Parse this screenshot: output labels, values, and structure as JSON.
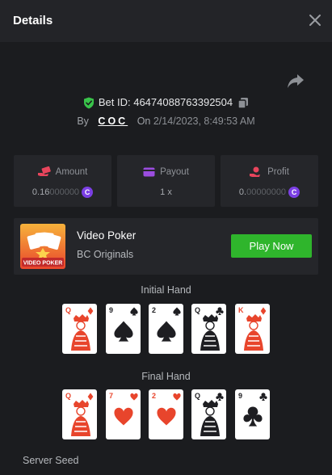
{
  "header": {
    "title": "Details"
  },
  "bet": {
    "id_text": "Bet ID: 46474088763392504",
    "by_label": "By",
    "user": "COC",
    "on_label": "On",
    "date": "2/14/2023, 8:49:53 AM"
  },
  "stats": {
    "amount": {
      "label": "Amount",
      "value_main": "0.16",
      "value_dim": "000000"
    },
    "payout": {
      "label": "Payout",
      "value": "1 x"
    },
    "profit": {
      "label": "Profit",
      "value_main": "0.",
      "value_dim": "00000000"
    }
  },
  "game": {
    "name": "Video Poker",
    "provider": "BC Originals",
    "thumb_text": "VIDEO POKER",
    "play_label": "Play Now"
  },
  "initial_hand": {
    "label": "Initial Hand",
    "cards": [
      {
        "rank": "Q",
        "suit": "diamonds",
        "color": "#e8452c"
      },
      {
        "rank": "9",
        "suit": "spades",
        "color": "#1e1e22"
      },
      {
        "rank": "2",
        "suit": "spades",
        "color": "#1e1e22"
      },
      {
        "rank": "Q",
        "suit": "clubs",
        "color": "#1e1e22"
      },
      {
        "rank": "K",
        "suit": "diamonds",
        "color": "#e8452c"
      }
    ]
  },
  "final_hand": {
    "label": "Final Hand",
    "cards": [
      {
        "rank": "Q",
        "suit": "diamonds",
        "color": "#e8452c"
      },
      {
        "rank": "7",
        "suit": "hearts",
        "color": "#e8452c"
      },
      {
        "rank": "2",
        "suit": "hearts",
        "color": "#e8452c"
      },
      {
        "rank": "Q",
        "suit": "clubs",
        "color": "#1e1e22"
      },
      {
        "rank": "9",
        "suit": "clubs",
        "color": "#1e1e22"
      }
    ]
  },
  "server_seed": {
    "label": "Server Seed"
  },
  "colors": {
    "accent_green": "#2fb52c",
    "coin_purple": "#7b3fe4",
    "shield_green": "#39c34a"
  }
}
